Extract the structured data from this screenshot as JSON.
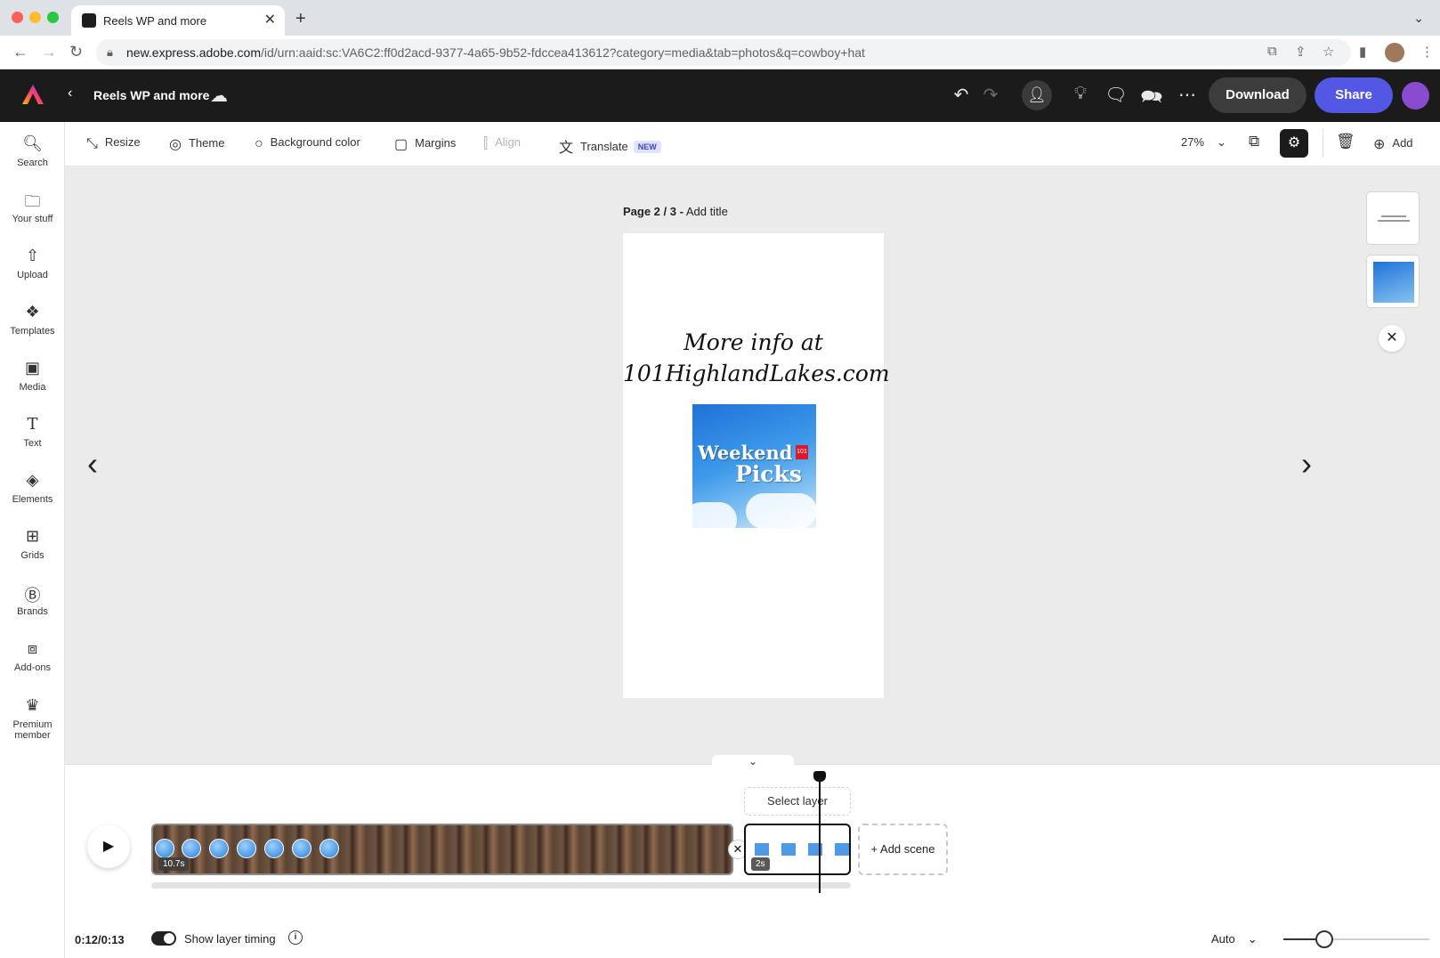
{
  "browser": {
    "tab_title": "Reels WP and more",
    "url_host": "new.express.adobe.com",
    "url_path": "/id/urn:aaid:sc:VA6C2:ff0d2acd-9377-4a65-9b52-fdccea413612?category=media&tab=photos&q=cowboy+hat"
  },
  "header": {
    "doc_title": "Reels WP and more",
    "download_label": "Download",
    "share_label": "Share"
  },
  "rail": {
    "items": [
      {
        "label": "Search",
        "icon": "search-icon"
      },
      {
        "label": "Your stuff",
        "icon": "folder-icon"
      },
      {
        "label": "Upload",
        "icon": "upload-icon"
      },
      {
        "label": "Templates",
        "icon": "templates-icon"
      },
      {
        "label": "Media",
        "icon": "media-icon"
      },
      {
        "label": "Text",
        "icon": "text-icon"
      },
      {
        "label": "Elements",
        "icon": "elements-icon"
      },
      {
        "label": "Grids",
        "icon": "grids-icon"
      },
      {
        "label": "Brands",
        "icon": "brands-icon"
      },
      {
        "label": "Add-ons",
        "icon": "addons-icon"
      },
      {
        "label": "Premium member",
        "icon": "premium-icon"
      }
    ]
  },
  "toolbar": {
    "resize": "Resize",
    "theme": "Theme",
    "background_color": "Background color",
    "margins": "Margins",
    "align": "Align",
    "translate": "Translate",
    "new_badge": "NEW",
    "zoom": "27%",
    "add": "Add"
  },
  "canvas": {
    "page_label_strong": "Page 2 / 3 -",
    "page_label_title": "Add title",
    "headline_line1": "More info at",
    "headline_line2": "101HighlandLakes.com",
    "image_word1": "Weekend",
    "image_word2": "Picks",
    "image_badge": "101"
  },
  "timeline": {
    "scene1_duration": "10.7s",
    "scene2_duration": "2s",
    "select_layer": "Select layer",
    "add_scene": "+ Add scene",
    "timecode": "0:12/0:13",
    "show_layer_timing": "Show layer timing",
    "auto": "Auto"
  },
  "colors": {
    "share_button": "#5258e4",
    "header_bg": "#1b1b1b"
  }
}
